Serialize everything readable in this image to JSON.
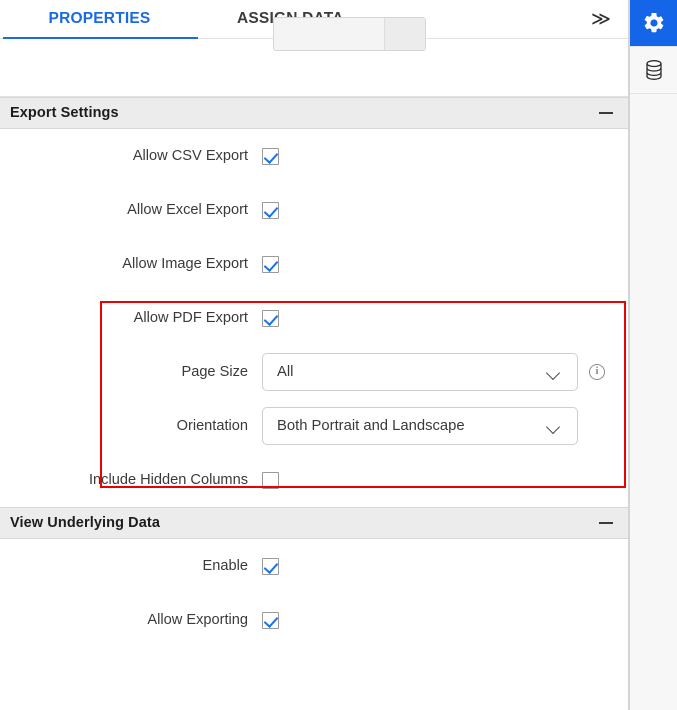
{
  "tabs": [
    {
      "id": "properties",
      "label": "PROPERTIES",
      "active": true
    },
    {
      "id": "assign-data",
      "label": "ASSIGN DATA",
      "active": false
    }
  ],
  "overflow_label": "≫",
  "rail": {
    "items": [
      {
        "icon": "gear-icon",
        "active": true
      },
      {
        "icon": "database-icon",
        "active": false
      }
    ],
    "active_color": "#1565e8"
  },
  "sections": [
    {
      "id": "export-settings",
      "title": "Export Settings",
      "collapse_icon": "minus-icon",
      "rows": [
        {
          "id": "allow-csv-export",
          "label": "Allow CSV Export",
          "type": "checkbox",
          "checked": true
        },
        {
          "id": "allow-excel-export",
          "label": "Allow Excel Export",
          "type": "checkbox",
          "checked": true
        },
        {
          "id": "allow-image-export",
          "label": "Allow Image Export",
          "type": "checkbox",
          "checked": true
        },
        {
          "id": "allow-pdf-export",
          "label": "Allow PDF Export",
          "type": "checkbox",
          "checked": true
        },
        {
          "id": "page-size",
          "label": "Page Size",
          "type": "select",
          "value": "All",
          "info": "i"
        },
        {
          "id": "orientation",
          "label": "Orientation",
          "type": "select",
          "value": "Both Portrait and Landscape"
        },
        {
          "id": "include-hidden-columns",
          "label": "Include Hidden Columns",
          "type": "checkbox",
          "checked": false
        }
      ]
    },
    {
      "id": "view-underlying-data",
      "title": "View Underlying Data",
      "collapse_icon": "minus-icon",
      "rows": [
        {
          "id": "enable",
          "label": "Enable",
          "type": "checkbox",
          "checked": true
        },
        {
          "id": "allow-exporting",
          "label": "Allow Exporting",
          "type": "checkbox",
          "checked": true
        }
      ]
    }
  ],
  "highlight": {
    "color": "#ee0000"
  },
  "colors": {
    "accent": "#1a6ae0",
    "check": "#1a73e8",
    "header_bg": "#ececec"
  }
}
